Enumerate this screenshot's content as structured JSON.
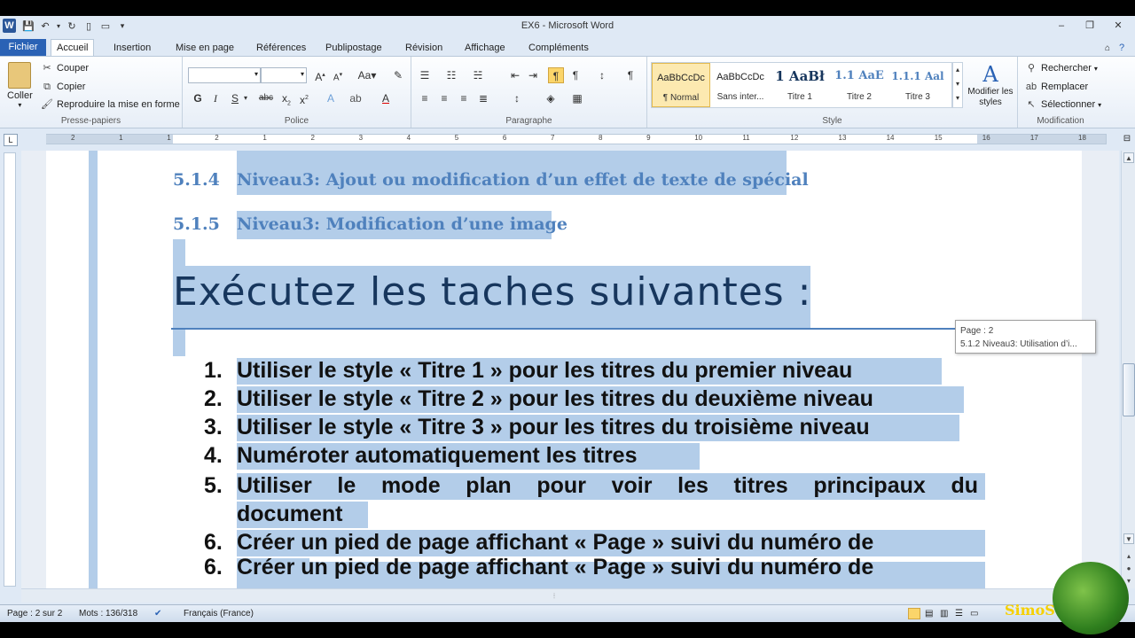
{
  "window": {
    "title": "EX6  -  Microsoft Word",
    "minimize": "–",
    "restore": "❐",
    "close": "✕"
  },
  "tabs": [
    "Fichier",
    "Accueil",
    "Insertion",
    "Mise en page",
    "Références",
    "Publipostage",
    "Révision",
    "Affichage",
    "Compléments"
  ],
  "ribbon": {
    "clipboard": {
      "label": "Presse-papiers",
      "paste": "Coller",
      "cut": "Couper",
      "copy": "Copier",
      "format_painter": "Reproduire la mise en forme"
    },
    "font": {
      "label": "Police",
      "font_name": "",
      "font_size": ""
    },
    "paragraph": {
      "label": "Paragraphe"
    },
    "styles": {
      "label": "Style",
      "items": [
        {
          "preview": "AaBbCcDc",
          "name": "¶ Normal"
        },
        {
          "preview": "AaBbCcDc",
          "name": "Sans inter..."
        },
        {
          "preview": "1  AaBł",
          "name": "Titre 1"
        },
        {
          "preview": "1.1  AaE",
          "name": "Titre 2"
        },
        {
          "preview": "1.1.1  Aal",
          "name": "Titre 3"
        }
      ],
      "modify": "Modifier les styles"
    },
    "editing": {
      "label": "Modification",
      "find": "Rechercher",
      "replace": "Remplacer",
      "select": "Sélectionner"
    }
  },
  "ruler": {
    "numbers": [
      "2",
      "1",
      "1",
      "2",
      "1",
      "2",
      "3",
      "4",
      "5",
      "6",
      "7",
      "8",
      "9",
      "10",
      "11",
      "12",
      "13",
      "14",
      "15",
      "16",
      "17",
      "18"
    ]
  },
  "document": {
    "headings3": [
      {
        "num": "5.1.4",
        "text": "Niveau3: Ajout ou modification d’un effet de texte de spécial"
      },
      {
        "num": "5.1.5",
        "text": "Niveau3: Modification d’une image"
      }
    ],
    "title": "Exécutez les taches suivantes :",
    "list": [
      {
        "num": "1.",
        "text": "Utiliser le style « Titre 1 » pour les titres du premier niveau"
      },
      {
        "num": "2.",
        "text": "Utiliser le style « Titre 2 » pour les titres du deuxième niveau"
      },
      {
        "num": "3.",
        "text": "Utiliser le style « Titre 3 » pour les titres du troisième niveau"
      },
      {
        "num": "4.",
        "text": "Numéroter automatiquement les titres"
      },
      {
        "num": "5.",
        "text": "Utiliser le mode plan pour voir les titres principaux du",
        "text2": "document"
      },
      {
        "num": "6.",
        "text": "Créer  un pied de page  affichant « Page  » suivi du numéro de"
      }
    ],
    "list_ghost": {
      "num": "6.",
      "text": "Créer  un pied de page  affichant « Page  » suivi du numéro de"
    }
  },
  "tooltip": {
    "line1": "Page : 2",
    "line2": "5.1.2 Niveau3: Utilisation d’i..."
  },
  "status": {
    "page": "Page : 2 sur 2",
    "words": "Mots : 136/318",
    "language": "Français (France)"
  },
  "watermark": "SimoS"
}
